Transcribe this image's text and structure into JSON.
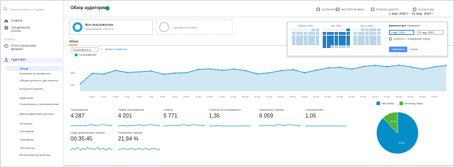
{
  "sidebar": {
    "search_placeholder": "Поиск в отчетах и Справке",
    "items": [
      {
        "label": "Главная",
        "icon": "home-icon"
      },
      {
        "label": "Специальные отчеты",
        "icon": "grid-icon"
      }
    ],
    "section_title": "ОТЧЕТЫ",
    "report_items": [
      {
        "label": "Отчет в реальном времени",
        "icon": "clock-icon"
      },
      {
        "label": "Аудитория",
        "icon": "person-icon"
      }
    ],
    "audience_sub": [
      "Обзор",
      "Активные пользователи",
      "Общая ценность для клиента",
      "Когортный анализ",
      "Аудитории",
      "Статистика по пользователям",
      "Демографические данные",
      "Интересы",
      "География",
      "Поведение",
      "Технологии",
      "Мобильные устройства"
    ]
  },
  "header": {
    "title": "Обзор аудитории",
    "tools": [
      "СОХРАНИТЬ",
      "ЭКСПОРТИРОВАТЬ",
      "ОТКРЫТЬ ДОСТУП",
      "СТАТИСТИКА"
    ],
    "date_range": "1 мар. 2020 г. - 31 мар. 2020 г."
  },
  "segments": {
    "active_name": "Все пользователи",
    "active_sub": "Пользователи: 100,00 %",
    "add_label": "+ Добавить сегмент"
  },
  "overview": {
    "tab": "Обзор",
    "metric_select": "Пользователи",
    "vs": "и",
    "compare_link": "Выбор показателя",
    "legend": "Пользователи"
  },
  "datepicker": {
    "months": [
      "февраль 2020 г.",
      "март 2020 г.",
      "апрель 2020 г."
    ],
    "range_label": "Диапазон дат:",
    "range_value": "Настроить",
    "start": "1 мар. 2020 г.",
    "end": "31 мар. 2020 г.",
    "compare_label": "Сравнить с:",
    "compare_value": "Предыдущий период",
    "apply": "Применить",
    "cancel": "отмена"
  },
  "chart_data": [
    {
      "type": "area",
      "title": "",
      "series": [
        {
          "name": "Пользователи",
          "values": [
            210,
            295,
            290,
            320,
            302,
            308,
            315,
            288,
            297,
            300,
            328,
            332,
            320,
            330,
            318,
            290,
            300,
            318,
            325,
            300,
            322,
            340,
            345,
            330,
            352,
            360,
            350,
            362,
            348,
            330,
            348,
            360
          ]
        }
      ],
      "yticks": [
        "300",
        "200"
      ],
      "ylim": [
        150,
        400
      ],
      "x_ticks": [
        "2 мар.",
        "3 мар.",
        "4 мар.",
        "5 мар.",
        "6 мар.",
        "7 мар.",
        "8 мар.",
        "9 мар.",
        "10 мар.",
        "11 мар.",
        "12 мар.",
        "13 мар.",
        "14 мар.",
        "15 мар.",
        "16 мар.",
        "17 мар.",
        "18 мар.",
        "19 мар.",
        "20 мар.",
        "21 мар.",
        "22 мар.",
        "23 мар.",
        "24 мар.",
        "25 мар.",
        "26 мар.",
        "27 мар.",
        "28 мар.",
        "29 мар.",
        "30 мар.",
        "31 мар."
      ],
      "color": "#058dc7",
      "fill": "#cfe8f3"
    },
    {
      "type": "pie",
      "series": [
        {
          "name": "New Visitor",
          "values": [
            87.8
          ]
        },
        {
          "name": "Returning Visitor",
          "values": [
            12.2
          ]
        }
      ],
      "slice_labels": [
        "87,8%",
        "12,2%"
      ],
      "colors": [
        "#058dc7",
        "#50b432"
      ],
      "legend_position": "top"
    }
  ],
  "metrics": [
    {
      "label": "Пользователи",
      "value": "4 287"
    },
    {
      "label": "Новые пользователи",
      "value": "4 201"
    },
    {
      "label": "Сеансы",
      "value": "5 771"
    },
    {
      "label": "Сеансов на пользователя",
      "value": "1,35"
    },
    {
      "label": "Просмотры страниц",
      "value": "6 059"
    },
    {
      "label": "Страниц/сеанс",
      "value": "1,05"
    },
    {
      "label": "Сред. длительность сеанса",
      "value": "00:35:45"
    },
    {
      "label": "Показатель отказов",
      "value": "21,94 %"
    }
  ]
}
